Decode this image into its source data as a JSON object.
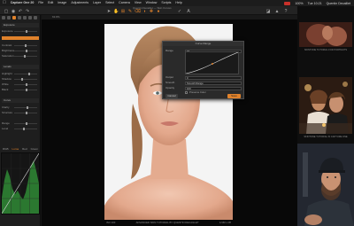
{
  "menubar": {
    "items": [
      "Capture One 20",
      "File",
      "Edit",
      "Image",
      "Adjustments",
      "Layer",
      "Select",
      "Camera",
      "View",
      "Window",
      "Scripts",
      "Help"
    ],
    "status": [
      "100%",
      "Tue 10:21",
      "Quentin Decaillet"
    ]
  },
  "toolbar": {
    "title": "Quentin Decaillet — Skin Curves"
  },
  "viewer": {
    "zoom": "63.8%",
    "bottom_left": "ISO 100",
    "bottom_center": "ADVANCED SKIN TUTORIAL BY QUENTIN DECAILLET",
    "bottom_right": "1/160 s  f/8"
  },
  "left_panel": {
    "rows": [
      "Exposure",
      "Contrast",
      "Brightness",
      "Saturation",
      "Highlight",
      "Shadow",
      "White",
      "Black",
      "Clarity",
      "Structure",
      "Range",
      "Level"
    ],
    "section_heads": [
      "Exposure",
      "Levels",
      "Curve"
    ],
    "histogram_tabs": [
      "RGB",
      "Luma",
      "Red",
      "Green"
    ],
    "histogram_active": "Luma"
  },
  "dialog": {
    "title": "Curve Range",
    "rows": [
      {
        "label": "Range",
        "value": "15"
      },
      {
        "label": "Output",
        "value": "0"
      },
      {
        "label": "Smooth",
        "value": "Smooth Range"
      },
      {
        "label": "Opacity",
        "value": "100"
      }
    ],
    "check_label": "Preserve Color",
    "cancel": "Cancel",
    "save": "Save"
  },
  "tutorials": [
    {
      "caption": "SKINTONE TUTORIAL FOR PORTRAITS"
    },
    {
      "caption": "SKINTONE TUTORIAL IN CAPTURE ONE"
    }
  ],
  "colors": {
    "accent": "#e0822b",
    "panel": "#1e1e1e",
    "viewer": "#080808"
  }
}
